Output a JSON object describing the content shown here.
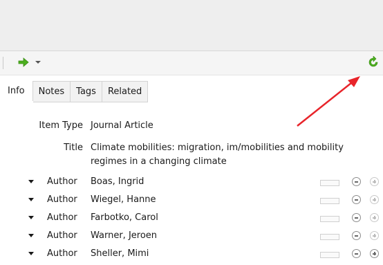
{
  "toolbar": {
    "locate_icon": "green-arrow-icon",
    "dropdown_icon": "chevron-down-icon",
    "refresh_icon": "sync-icon",
    "accent": "#4caf1f"
  },
  "tabs": [
    {
      "label": "Info",
      "active": true
    },
    {
      "label": "Notes",
      "active": false
    },
    {
      "label": "Tags",
      "active": false
    },
    {
      "label": "Related",
      "active": false
    }
  ],
  "fields": {
    "item_type_label": "Item Type",
    "item_type_value": "Journal Article",
    "title_label": "Title",
    "title_value": "Climate mobilities: migration, im/mobilities and mobility regimes in a changing climate"
  },
  "authors": [
    {
      "label": "Author",
      "name": "Boas, Ingrid"
    },
    {
      "label": "Author",
      "name": "Wiegel, Hanne"
    },
    {
      "label": "Author",
      "name": "Farbotko, Carol"
    },
    {
      "label": "Author",
      "name": "Warner, Jeroen"
    },
    {
      "label": "Author",
      "name": "Sheller, Mimi"
    }
  ],
  "annotation": {
    "color": "#e8242a"
  }
}
